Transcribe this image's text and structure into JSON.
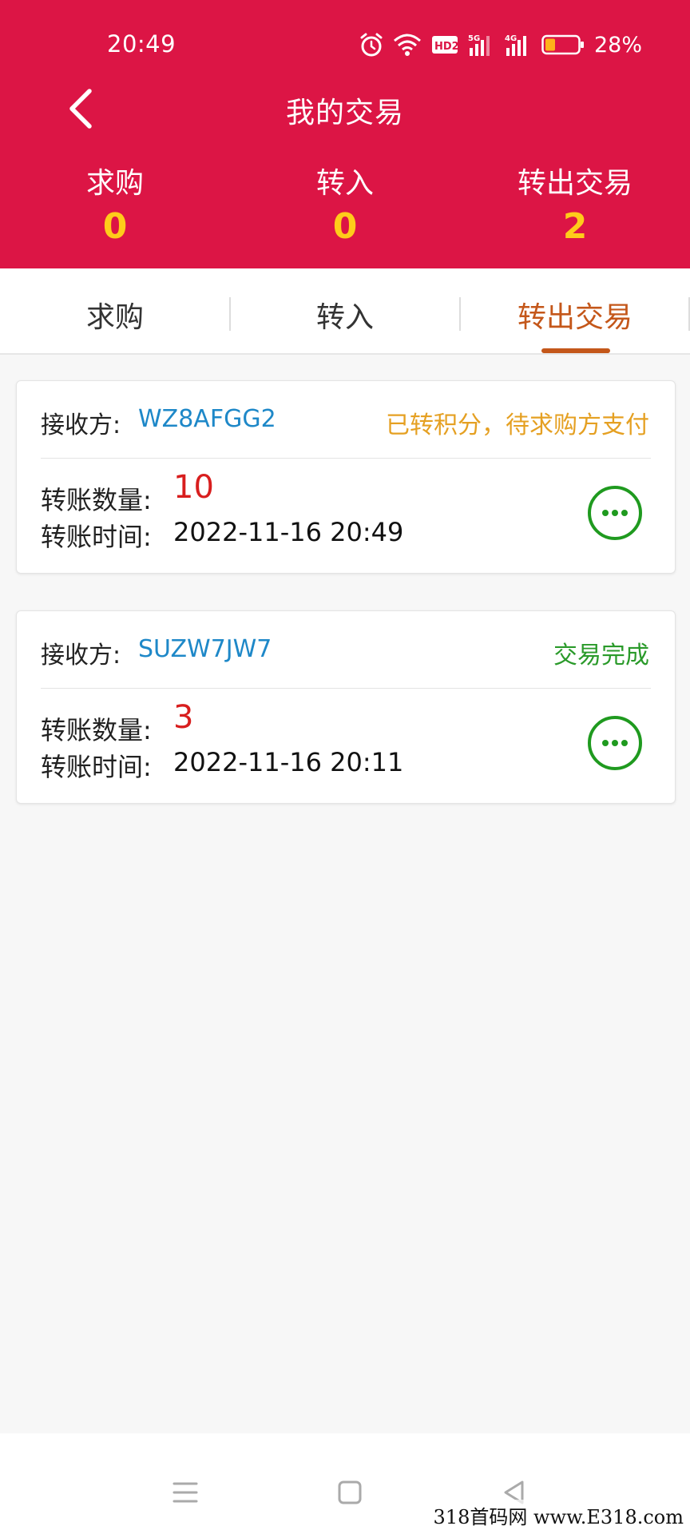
{
  "status_bar": {
    "time": "20:49",
    "battery_percent": "28%",
    "network_labels": [
      "HD2",
      "5G",
      "4G"
    ],
    "icons": [
      "alarm-icon",
      "wifi-icon",
      "hd-icon",
      "signal-5g-icon",
      "signal-4g-icon",
      "battery-icon"
    ]
  },
  "header": {
    "title": "我的交易",
    "back_icon": "chevron-left-icon",
    "stats": [
      {
        "label": "求购",
        "value": "0"
      },
      {
        "label": "转入",
        "value": "0"
      },
      {
        "label": "转出交易",
        "value": "2"
      }
    ]
  },
  "tabs": [
    {
      "label": "求购",
      "active": false
    },
    {
      "label": "转入",
      "active": false
    },
    {
      "label": "转出交易",
      "active": true
    }
  ],
  "transactions": [
    {
      "receiver_label": "接收方:",
      "receiver_id": "WZ8AFGG2",
      "status": "已转积分，待求购方支付",
      "status_color": "#e5a022",
      "amount_label": "转账数量:",
      "amount": "10",
      "time_label": "转账时间:",
      "time": "2022-11-16 20:49"
    },
    {
      "receiver_label": "接收方:",
      "receiver_id": "SUZW7JW7",
      "status": "交易完成",
      "status_color": "#2a9a2a",
      "amount_label": "转账数量:",
      "amount": "3",
      "time_label": "转账时间:",
      "time": "2022-11-16 20:11"
    }
  ],
  "system_nav": {
    "icons": [
      "menu-icon",
      "home-icon",
      "back-triangle-icon"
    ]
  },
  "watermark": "318首码网 www.E318.com",
  "colors": {
    "header_bg": "#dc1545",
    "stat_value": "#ffcc1a",
    "active_tab": "#c4571a",
    "receiver_id": "#1e88c8",
    "amount": "#d81e1e",
    "more_button": "#1f9a1f"
  }
}
